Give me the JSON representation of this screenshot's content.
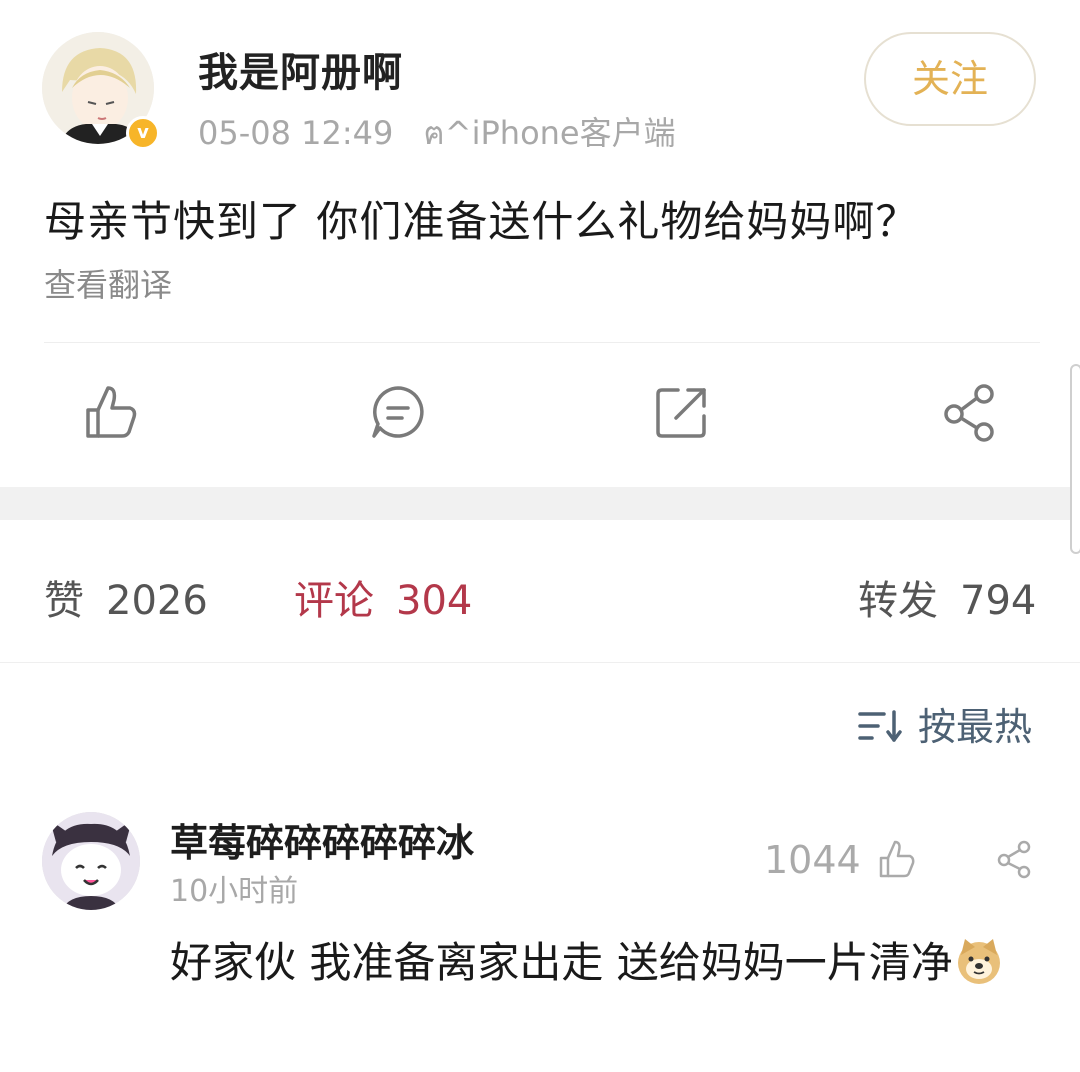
{
  "post": {
    "author": "我是阿册啊",
    "time": "05-08 12:49",
    "source": "ฅ^iPhone客户端",
    "follow_label": "关注",
    "verified_badge": "v",
    "text": "母亲节快到了 你们准备送什么礼物给妈妈啊？",
    "translate_label": "查看翻译"
  },
  "actions": {
    "icons": [
      "thumbs-up-icon",
      "comment-icon",
      "repost-icon",
      "share-icon"
    ]
  },
  "stats": {
    "likes_label": "赞",
    "likes_count": "2026",
    "comments_label": "评论",
    "comments_count": "304",
    "reposts_label": "转发",
    "reposts_count": "794"
  },
  "sort": {
    "label": "按最热"
  },
  "comment": {
    "author": "草莓碎碎碎碎碎冰",
    "time": "10小时前",
    "likes": "1044",
    "text": "好家伙 我准备离家出走 送给妈妈一片清净"
  },
  "colors": {
    "accent_follow": "#e3b255",
    "comments_active": "#b3384a",
    "sort_text": "#4d6174",
    "verified": "#f7b529"
  }
}
